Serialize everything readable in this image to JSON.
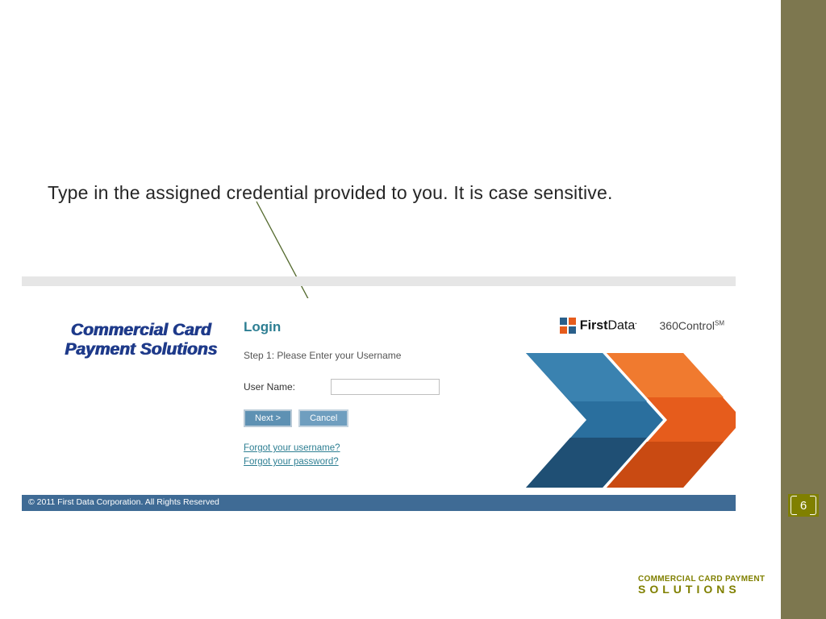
{
  "instruction": "Type in the assigned credential provided to you.  It is case sensitive.",
  "panel": {
    "brand_line1": "Commercial Card",
    "brand_line2": "Payment Solutions",
    "login_title": "Login",
    "step_text": "Step 1: Please Enter your Username",
    "username_label": "User Name:",
    "username_value": "",
    "next_label": "Next >",
    "cancel_label": "Cancel",
    "forgot_user": "Forgot your username?",
    "forgot_pass": "Forgot your password?",
    "first_data_bold": "First",
    "first_data_thin": "Data",
    "control_label": "360Control",
    "sm": "SM"
  },
  "footer": "© 2011 First Data Corporation. All Rights Reserved",
  "footer_brand": {
    "l1": "COMMERCIAL CARD PAYMENT",
    "l2": "SOLUTIONS"
  },
  "page_number": "6"
}
